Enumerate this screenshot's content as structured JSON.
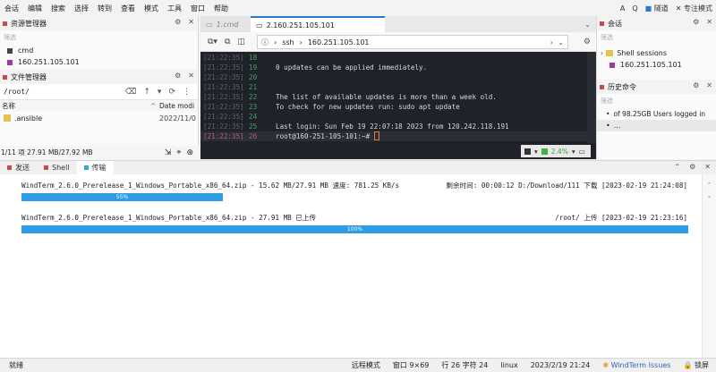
{
  "menubar": {
    "items": [
      "会话",
      "编辑",
      "搜索",
      "选择",
      "转到",
      "查看",
      "模式",
      "工具",
      "窗口",
      "帮助"
    ],
    "right_items": [
      "A",
      "Q",
      "隧道",
      "专注模式"
    ]
  },
  "explorer": {
    "title": "资源管理器",
    "filter_placeholder": "筛选",
    "items": [
      {
        "label": "cmd",
        "color": "#444444"
      },
      {
        "label": "160.251.105.101",
        "color": "#9b3aa3"
      }
    ]
  },
  "file_manager": {
    "title": "文件管理器",
    "path": "/root/",
    "col_name": "名称",
    "col_date": "Date modi",
    "rows": [
      {
        "name": ".ansible",
        "date": "2022/11/0"
      }
    ],
    "summary": "1/11 项 27.91 MB/27.92 MB"
  },
  "terminal": {
    "tabs": [
      {
        "label": "1.cmd",
        "active": false
      },
      {
        "label": "2.160.251.105.101",
        "active": true
      }
    ],
    "address": {
      "proto": "ssh",
      "host": "160.251.105.101"
    },
    "lines": [
      {
        "ts": "[21:22:35]",
        "ln": "18",
        "text": ""
      },
      {
        "ts": "[21:22:35]",
        "ln": "19",
        "text": "0 updates can be applied immediately."
      },
      {
        "ts": "[21:22:35]",
        "ln": "20",
        "text": ""
      },
      {
        "ts": "[21:22:35]",
        "ln": "21",
        "text": ""
      },
      {
        "ts": "[21:22:35]",
        "ln": "22",
        "text": "The list of available updates is more than a week old."
      },
      {
        "ts": "[21:22:35]",
        "ln": "23",
        "text": "To check for new updates run: sudo apt update"
      },
      {
        "ts": "[21:22:35]",
        "ln": "24",
        "text": ""
      },
      {
        "ts": "[21:22:35]",
        "ln": "25",
        "text": "Last login: Sun Feb 19 22:07:18 2023 from 120.242.118.191"
      },
      {
        "ts": "[21:22:35]",
        "ln": "26",
        "text": "root@160-251-105-101:~# "
      }
    ],
    "cpu": "2.4%"
  },
  "sessions": {
    "title": "会话",
    "filter_placeholder": "筛选",
    "folder": "Shell sessions",
    "items": [
      "160.251.105.101"
    ]
  },
  "history": {
    "title": "历史命令",
    "filter_placeholder": "筛选",
    "items": [
      "of 98.25GB Users logged in",
      "..."
    ]
  },
  "bottom_tabs": [
    {
      "label": "发送",
      "color": "#c94a4a",
      "active": false
    },
    {
      "label": "Shell",
      "color": "#c94a4a",
      "active": false
    },
    {
      "label": "传输",
      "color": "#2ab0c0",
      "active": true
    }
  ],
  "transfers": [
    {
      "name": "WindTerm_2.6.0_Prerelease_1_Windows_Portable_x86_64.zip - 15.62 MB/27.91 MB 速度: 781.25 KB/s",
      "meta": "剩余时间: 00:00:12 D:/Download/111 下载 [2023-02-19 21:24:08]",
      "progress": 0.55,
      "label": "55%"
    },
    {
      "name": "WindTerm_2.6.0_Prerelease_1_Windows_Portable_x86_64.zip - 27.91 MB 已上传",
      "meta": "/root/ 上传 [2023-02-19 21:23:16]",
      "progress": 1.0,
      "label": "100%"
    }
  ],
  "statusbar": {
    "left": "就绪",
    "mode": "远程模式",
    "window": "窗口 9×69",
    "cursor": "行 26 字符 24",
    "os": "linux",
    "datetime": "2023/2/19 21:24",
    "issues": "WindTerm Issues",
    "lock": "锁屏"
  }
}
